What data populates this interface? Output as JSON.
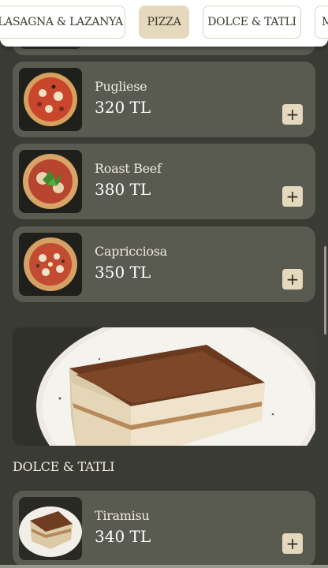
{
  "tabs": [
    {
      "label": "LASAGNA & LAZANYA",
      "active": false
    },
    {
      "label": "PIZZA",
      "active": true
    },
    {
      "label": "DOLCE & TATLI",
      "active": false
    },
    {
      "label": "M",
      "active": false
    }
  ],
  "products": [
    {
      "name": "Pugliese",
      "price": "320 TL",
      "add_label": "+",
      "icon": "pizza-pugliese"
    },
    {
      "name": "Roast Beef",
      "price": "380 TL",
      "add_label": "+",
      "icon": "pizza-roast-beef"
    },
    {
      "name": "Capricciosa",
      "price": "350 TL",
      "add_label": "+",
      "icon": "pizza-capricciosa"
    }
  ],
  "banner": {
    "icon": "tiramisu-photo"
  },
  "dolce_section": {
    "title": "DOLCE & TATLI",
    "items": [
      {
        "name": "Tiramisu",
        "price": "340 TL",
        "add_label": "+",
        "icon": "tiramisu-photo"
      }
    ]
  },
  "colors": {
    "background": "#3a3b33",
    "card": "#595a50",
    "accent": "#e4d8bd",
    "text": "#f0ebdf"
  }
}
